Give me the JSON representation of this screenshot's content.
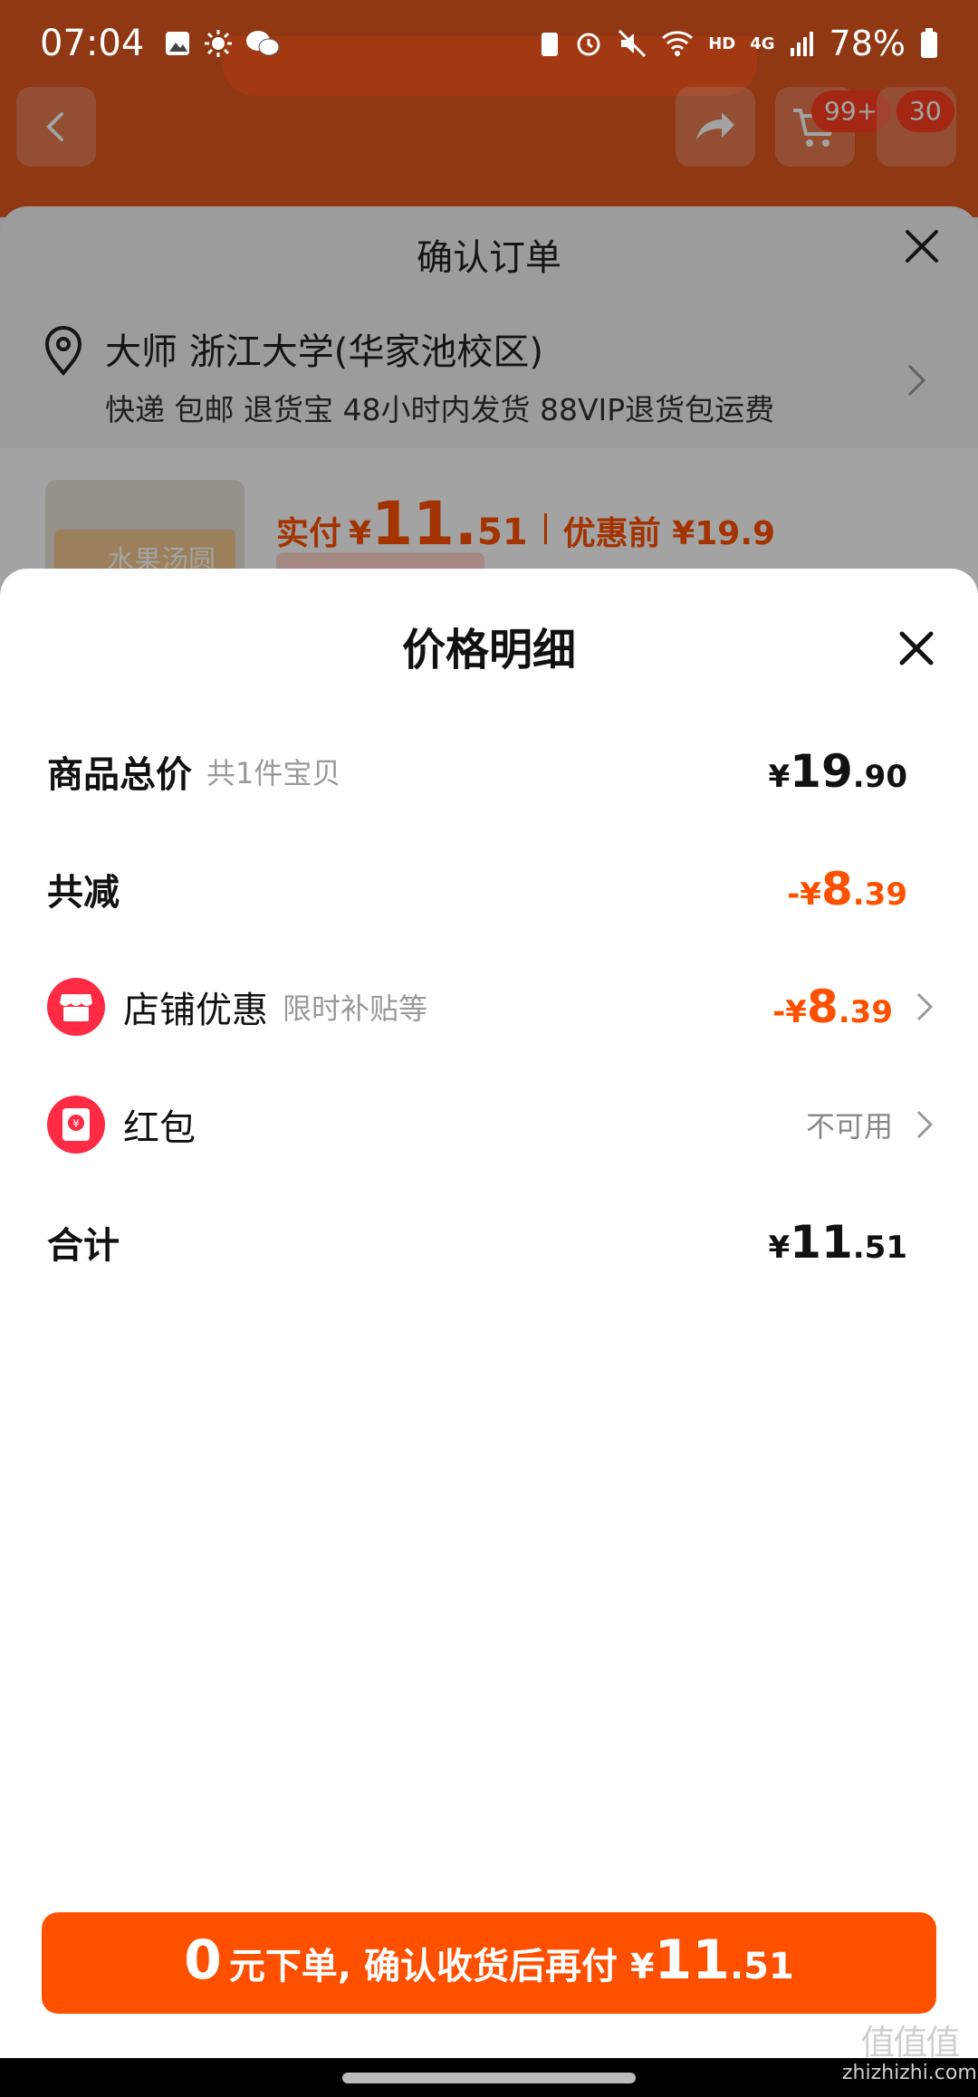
{
  "status_bar": {
    "time": "07:04",
    "battery": "78%",
    "network": "4G",
    "hd": "HD"
  },
  "background": {
    "cart_badge": "99+",
    "msg_badge": "30",
    "order_title": "确认订单",
    "address_name": "大师 浙江大学(华家池校区)",
    "address_tags": "快递 包邮 退货宝 48小时内发货 88VIP退货包运费",
    "product_thumb_text": "水果汤圆",
    "product_price": {
      "label": "实付",
      "currency": "¥",
      "integer": "11.",
      "decimal": "51",
      "before_label": "优惠前 ¥19.9"
    }
  },
  "detail": {
    "title": "价格明细",
    "rows": [
      {
        "label": "商品总价",
        "sub": "共1件宝贝",
        "currency": "¥",
        "integer": "19",
        "decimal": ".90"
      },
      {
        "label": "共减",
        "currency": "-¥",
        "integer": "8",
        "decimal": ".39"
      },
      {
        "label": "店铺优惠",
        "sub": "限时补贴等",
        "currency": "-¥",
        "integer": "8",
        "decimal": ".39"
      },
      {
        "label": "红包",
        "value_text": "不可用"
      },
      {
        "label": "合计",
        "currency": "¥",
        "integer": "11",
        "decimal": ".51"
      }
    ]
  },
  "cta": {
    "big": "0",
    "text": "元下单, 确认收货后再付",
    "currency": "¥",
    "integer": "11",
    "decimal": ".51"
  },
  "watermark": {
    "logo": "值值值",
    "site": "zhizhizhi.com"
  },
  "colors": {
    "accent": "#ff5000",
    "icon_red": "#ff2a44",
    "muted": "#999999"
  }
}
